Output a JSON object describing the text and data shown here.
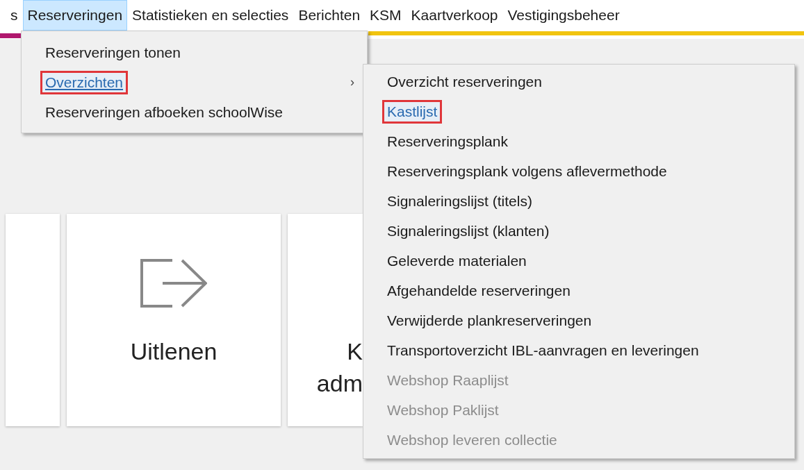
{
  "menubar": [
    {
      "label": "s",
      "selected": false
    },
    {
      "label": "Reserveringen",
      "selected": true
    },
    {
      "label": "Statistieken en selecties",
      "selected": false
    },
    {
      "label": "Berichten",
      "selected": false
    },
    {
      "label": "KSM",
      "selected": false
    },
    {
      "label": "Kaartverkoop",
      "selected": false
    },
    {
      "label": "Vestigingsbeheer",
      "selected": false
    }
  ],
  "dropdown": {
    "items": [
      {
        "label": "Reserveringen tonen",
        "highlighted": false
      },
      {
        "label": "Overzichten",
        "highlighted": true,
        "submenu_arrow": "›"
      },
      {
        "label": "Reserveringen afboeken schoolWise",
        "highlighted": false
      }
    ]
  },
  "submenu": {
    "items": [
      {
        "label": "Overzicht reserveringen",
        "highlighted": false,
        "disabled": false
      },
      {
        "label": "Kastlijst",
        "highlighted": true,
        "disabled": false
      },
      {
        "label": "Reserveringsplank",
        "highlighted": false,
        "disabled": false
      },
      {
        "label": "Reserveringsplank volgens aflevermethode",
        "highlighted": false,
        "disabled": false
      },
      {
        "label": "Signaleringslijst (titels)",
        "highlighted": false,
        "disabled": false
      },
      {
        "label": "Signaleringslijst (klanten)",
        "highlighted": false,
        "disabled": false
      },
      {
        "label": "Geleverde materialen",
        "highlighted": false,
        "disabled": false
      },
      {
        "label": "Afgehandelde reserveringen",
        "highlighted": false,
        "disabled": false
      },
      {
        "label": "Verwijderde plankreserveringen",
        "highlighted": false,
        "disabled": false
      },
      {
        "label": "Transportoverzicht IBL-aanvragen en leveringen",
        "highlighted": false,
        "disabled": false
      },
      {
        "label": "Webshop Raaplijst",
        "highlighted": false,
        "disabled": true
      },
      {
        "label": "Webshop Paklijst",
        "highlighted": false,
        "disabled": true
      },
      {
        "label": "Webshop leveren collectie",
        "highlighted": false,
        "disabled": true
      }
    ]
  },
  "tiles": [
    {
      "kind": "blank"
    },
    {
      "kind": "export",
      "lines": [
        "Uitlenen"
      ]
    },
    {
      "kind": "blank",
      "lines": [
        "K",
        "adm"
      ]
    }
  ]
}
